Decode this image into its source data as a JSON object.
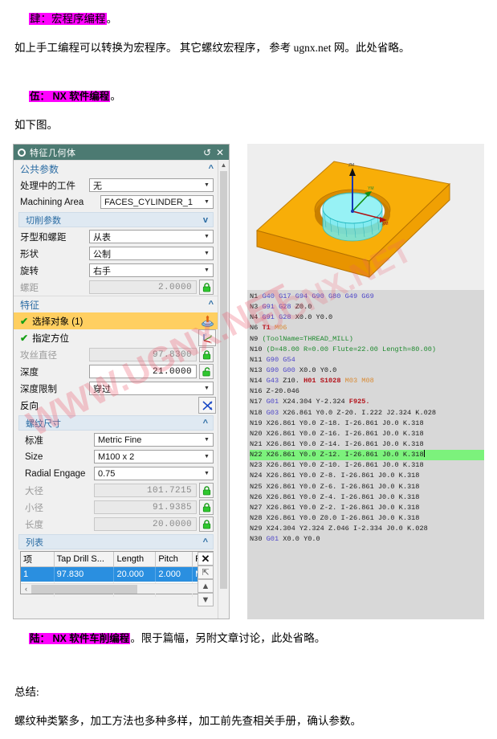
{
  "document": {
    "section4_heading_highlight": "肆：宏程序编程",
    "section4_heading_tail": "。",
    "section4_body": "如上手工编程可以转换为宏程序。 其它螺纹宏程序， 参考 ugnx.net 网。此处省略。",
    "section5_heading_highlight": "伍： NX 软件编程",
    "section5_heading_tail": "。",
    "section5_body": "如下图。",
    "section6_heading_highlight": "陆： NX 软件车削编程",
    "section6_body": "。限于篇幅，另附文章讨论，此处省略。",
    "summary_label": "总结:",
    "summary_body": "螺纹种类繁多，加工方法也多种多样，加工前先查相关手册，确认参数。"
  },
  "watermark": {
    "text_left": "WWW.UGNX.NET",
    "text_right": "UGNX.NET",
    "color": "#ec5a6e"
  },
  "dialog": {
    "title": "特征几何体",
    "title_icon": "gear-icon",
    "reset_icon": "reset-icon",
    "close_icon": "close-icon",
    "accent_color": "#4c7a72",
    "groups": {
      "common": {
        "title": "公共参数",
        "collapse_state": "^",
        "rows": [
          {
            "label": "处理中的工件",
            "value": "无",
            "type": "combo",
            "enabled": true
          },
          {
            "label": "Machining Area",
            "value": "FACES_CYLINDER_1",
            "type": "combo",
            "enabled": true
          }
        ]
      },
      "cutting": {
        "title": "切削参数",
        "collapse_state": "v",
        "rows": [
          {
            "label": "牙型和螺距",
            "value": "从表",
            "type": "combo",
            "enabled": true
          },
          {
            "label": "形状",
            "value": "公制",
            "type": "combo",
            "enabled": true
          },
          {
            "label": "旋转",
            "value": "右手",
            "type": "combo",
            "enabled": true
          },
          {
            "label": "螺距",
            "value": "2.0000",
            "type": "number",
            "enabled": false,
            "lock": "locked"
          }
        ]
      },
      "feature": {
        "title": "特征",
        "collapse_state": "^",
        "select_object_label": "选择对象 (1)",
        "select_object_icon": "select-object-icon",
        "specify_orientation_label": "指定方位",
        "specify_orientation_icon": "csys-icon",
        "rows": [
          {
            "label": "攻丝直径",
            "value": "97.8300",
            "type": "number",
            "enabled": false,
            "lock": "locked"
          },
          {
            "label": "深度",
            "value": "21.0000",
            "type": "number",
            "enabled": true,
            "lock": "unlocked"
          },
          {
            "label": "深度限制",
            "value": "穿过",
            "type": "combo",
            "enabled": true
          }
        ],
        "reverse_label": "反向",
        "reverse_icon": "reverse-direction-icon"
      },
      "thread_size": {
        "title": "螺纹尺寸",
        "collapse_state": "^",
        "rows": [
          {
            "label": "标准",
            "value": "Metric Fine",
            "type": "combo",
            "enabled": true
          },
          {
            "label": "Size",
            "value": "M100 x 2",
            "type": "combo",
            "enabled": true
          },
          {
            "label": "Radial Engage",
            "value": "0.75",
            "type": "combo",
            "enabled": true
          },
          {
            "label": "大径",
            "value": "101.7215",
            "type": "number",
            "enabled": false,
            "lock": "locked"
          },
          {
            "label": "小径",
            "value": "91.9385",
            "type": "number",
            "enabled": false,
            "lock": "locked"
          },
          {
            "label": "长度",
            "value": "20.0000",
            "type": "number",
            "enabled": false,
            "lock": "locked"
          }
        ]
      },
      "list": {
        "title": "列表",
        "collapse_state": "^",
        "columns": [
          "项",
          "Tap Drill S...",
          "Length",
          "Pitch",
          "F"
        ],
        "rows": [
          [
            "1",
            "97.830",
            "20.000",
            "2.000",
            "M"
          ]
        ],
        "buttons": [
          {
            "name": "delete",
            "glyph": "✕"
          },
          {
            "name": "move-to-top",
            "glyph": "⇱"
          },
          {
            "name": "move-up",
            "glyph": "▲"
          },
          {
            "name": "move-down",
            "glyph": "▼"
          }
        ]
      }
    }
  },
  "viewport": {
    "name": "3d-model-viewport",
    "background": "#eeeeee",
    "part_color": "#f5a200",
    "feature_color": "#4fe3e3",
    "axis_labels": [
      "ZM",
      "YM",
      "XM"
    ]
  },
  "gcode": {
    "highlight_color": "#7cf27c",
    "highlighted_line_index": 15,
    "lines": [
      [
        [
          "N1 ",
          "n"
        ],
        [
          "G40 G17 G94 G90 G80 G49 G69",
          "g"
        ]
      ],
      [
        [
          "N3 ",
          "n"
        ],
        [
          "G91 G28 ",
          "g"
        ],
        [
          "Z0.0",
          "n"
        ]
      ],
      [
        [
          "N4 ",
          "n"
        ],
        [
          "G91 G28 ",
          "g"
        ],
        [
          "X0.0 Y0.0",
          "n"
        ]
      ],
      [
        [
          "N6 ",
          "n"
        ],
        [
          "T1 ",
          "r"
        ],
        [
          "M06",
          "o"
        ]
      ],
      [
        [
          "N9 ",
          "n"
        ],
        [
          "(ToolName=THREAD_MILL)",
          "gr"
        ]
      ],
      [
        [
          "N10 ",
          "n"
        ],
        [
          "(D=48.00 R=0.00 Flute=22.00 Length=80.00)",
          "gr"
        ]
      ],
      [
        [
          "N11 ",
          "n"
        ],
        [
          "G90 G54",
          "g"
        ]
      ],
      [
        [
          "N13 ",
          "n"
        ],
        [
          "G90 G00 ",
          "g"
        ],
        [
          "X0.0 Y0.0",
          "n"
        ]
      ],
      [
        [
          "N14 ",
          "n"
        ],
        [
          "G43 ",
          "g"
        ],
        [
          "Z10. ",
          "n"
        ],
        [
          "H01 S1028 ",
          "r"
        ],
        [
          "M03 M08",
          "o"
        ]
      ],
      [
        [
          "N16 ",
          "n"
        ],
        [
          "Z-20.046",
          "n"
        ]
      ],
      [
        [
          "N17 ",
          "n"
        ],
        [
          "G01 ",
          "g"
        ],
        [
          "X24.304 Y-2.324 ",
          "n"
        ],
        [
          "F925.",
          "r"
        ]
      ],
      [
        [
          "N18 ",
          "n"
        ],
        [
          "G03 ",
          "g"
        ],
        [
          "X26.861 Y0.0 Z-20. I.222 J2.324 K.028",
          "n"
        ]
      ],
      [
        [
          "N19 ",
          "n"
        ],
        [
          "X26.861 Y0.0 Z-18. I-26.861 J0.0 K.318",
          "n"
        ]
      ],
      [
        [
          "N20 ",
          "n"
        ],
        [
          "X26.861 Y0.0 Z-16. I-26.861 J0.0 K.318",
          "n"
        ]
      ],
      [
        [
          "N21 ",
          "n"
        ],
        [
          "X26.861 Y0.0 Z-14. I-26.861 J0.0 K.318",
          "n"
        ]
      ],
      [
        [
          "N22 ",
          "n"
        ],
        [
          "X26.861 Y0.0 Z-12. I-26.861 J0.0 K.318",
          "n"
        ]
      ],
      [
        [
          "N23 ",
          "n"
        ],
        [
          "X26.861 Y0.0 Z-10. I-26.861 J0.0 K.318",
          "n"
        ]
      ],
      [
        [
          "N24 ",
          "n"
        ],
        [
          "X26.861 Y0.0 Z-8. I-26.861 J0.0 K.318",
          "n"
        ]
      ],
      [
        [
          "N25 ",
          "n"
        ],
        [
          "X26.861 Y0.0 Z-6. I-26.861 J0.0 K.318",
          "n"
        ]
      ],
      [
        [
          "N26 ",
          "n"
        ],
        [
          "X26.861 Y0.0 Z-4. I-26.861 J0.0 K.318",
          "n"
        ]
      ],
      [
        [
          "N27 ",
          "n"
        ],
        [
          "X26.861 Y0.0 Z-2. I-26.861 J0.0 K.318",
          "n"
        ]
      ],
      [
        [
          "N28 ",
          "n"
        ],
        [
          "X26.861 Y0.0 Z0.0 I-26.861 J0.0 K.318",
          "n"
        ]
      ],
      [
        [
          "N29 ",
          "n"
        ],
        [
          "X24.304 Y2.324 Z.046 I-2.334 J0.0 K.028",
          "n"
        ]
      ],
      [
        [
          "N30 ",
          "n"
        ],
        [
          "G01 ",
          "g"
        ],
        [
          "X0.0 Y0.0",
          "n"
        ]
      ]
    ]
  }
}
